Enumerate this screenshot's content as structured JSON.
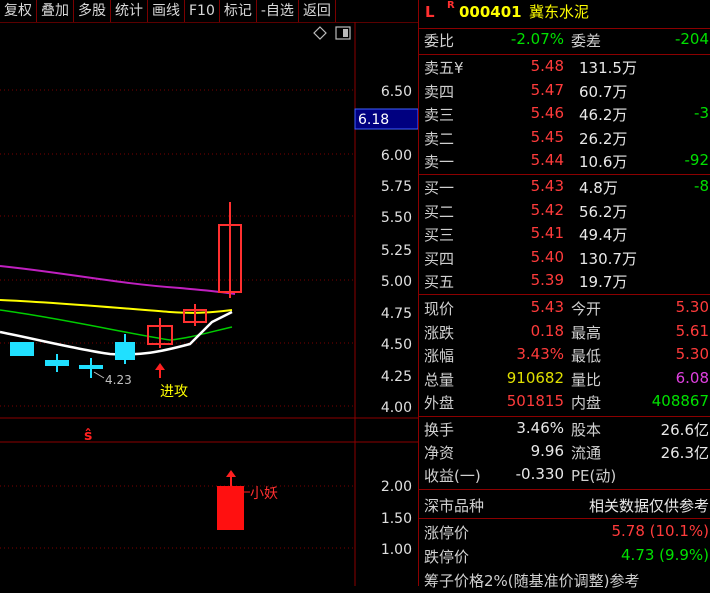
{
  "toolbar": {
    "buttons": [
      "复权",
      "叠加",
      "多股",
      "统计",
      "画线",
      "F10",
      "标记",
      "-自选",
      "返回"
    ]
  },
  "chart": {
    "price_ticks": [
      "6.50",
      "6.18",
      "6.00",
      "5.75",
      "5.50",
      "5.25",
      "5.00",
      "4.75",
      "4.50",
      "4.25",
      "4.00"
    ],
    "current_price_label": "6.18",
    "low_marker": "4.23",
    "signal_label": "进攻",
    "s_marker": "ŝ",
    "vol_ticks": [
      "2.00",
      "1.50",
      "1.00"
    ],
    "vol_label": "小妖",
    "colors": {
      "up": "#ff3030",
      "down": "#20e0ff",
      "ma1": "#ffffff",
      "ma2": "#ffff00",
      "ma3": "#00cc00",
      "ma4": "#c020c0"
    }
  },
  "quote": {
    "header": {
      "flag": "L",
      "r": "R",
      "code": "000401",
      "name": "冀东水泥"
    },
    "weibi": {
      "label": "委比",
      "value": "-2.07%",
      "label2": "委差",
      "value2": "-204"
    },
    "asks": [
      {
        "label": "卖五¥",
        "price": "5.48",
        "vol": "131.5万",
        "extra": ""
      },
      {
        "label": "卖四",
        "price": "5.47",
        "vol": "60.7万",
        "extra": ""
      },
      {
        "label": "卖三",
        "price": "5.46",
        "vol": "46.2万",
        "extra": "-3"
      },
      {
        "label": "卖二",
        "price": "5.45",
        "vol": "26.2万",
        "extra": ""
      },
      {
        "label": "卖一",
        "price": "5.44",
        "vol": "10.6万",
        "extra": "-92"
      }
    ],
    "bids": [
      {
        "label": "买一",
        "price": "5.43",
        "vol": "4.8万",
        "extra": "-8"
      },
      {
        "label": "买二",
        "price": "5.42",
        "vol": "56.2万",
        "extra": ""
      },
      {
        "label": "买三",
        "price": "5.41",
        "vol": "49.4万",
        "extra": ""
      },
      {
        "label": "买四",
        "price": "5.40",
        "vol": "130.7万",
        "extra": ""
      },
      {
        "label": "买五",
        "price": "5.39",
        "vol": "19.7万",
        "extra": ""
      }
    ],
    "stats": [
      {
        "l1": "现价",
        "v1": "5.43",
        "c1": "red",
        "l2": "今开",
        "v2": "5.30",
        "c2": "red"
      },
      {
        "l1": "涨跌",
        "v1": "0.18",
        "c1": "red",
        "l2": "最高",
        "v2": "5.61",
        "c2": "red"
      },
      {
        "l1": "涨幅",
        "v1": "3.43%",
        "c1": "red",
        "l2": "最低",
        "v2": "5.30",
        "c2": "red"
      },
      {
        "l1": "总量",
        "v1": "910682",
        "c1": "yel",
        "l2": "量比",
        "v2": "6.08",
        "c2": "mag"
      },
      {
        "l1": "外盘",
        "v1": "501815",
        "c1": "red",
        "l2": "内盘",
        "v2": "408867",
        "c2": "green"
      }
    ],
    "fund": [
      {
        "l1": "换手",
        "v1": "3.46%",
        "l2": "股本",
        "v2": "26.6亿"
      },
      {
        "l1": "净资",
        "v1": "9.96",
        "l2": "流通",
        "v2": "26.3亿"
      },
      {
        "l1": "收益(一)",
        "v1": "-0.330",
        "l2": "PE(动)",
        "v2": ""
      }
    ],
    "market": {
      "label": "深市品种",
      "note": "相关数据仅供参考"
    },
    "limits": [
      {
        "label": "涨停价",
        "value": "5.78 (10.1%)",
        "color": "red"
      },
      {
        "label": "跌停价",
        "value": "4.73 (9.9%)",
        "color": "green"
      }
    ],
    "footer": "筹子价格2%(随基准价调整)参考"
  }
}
